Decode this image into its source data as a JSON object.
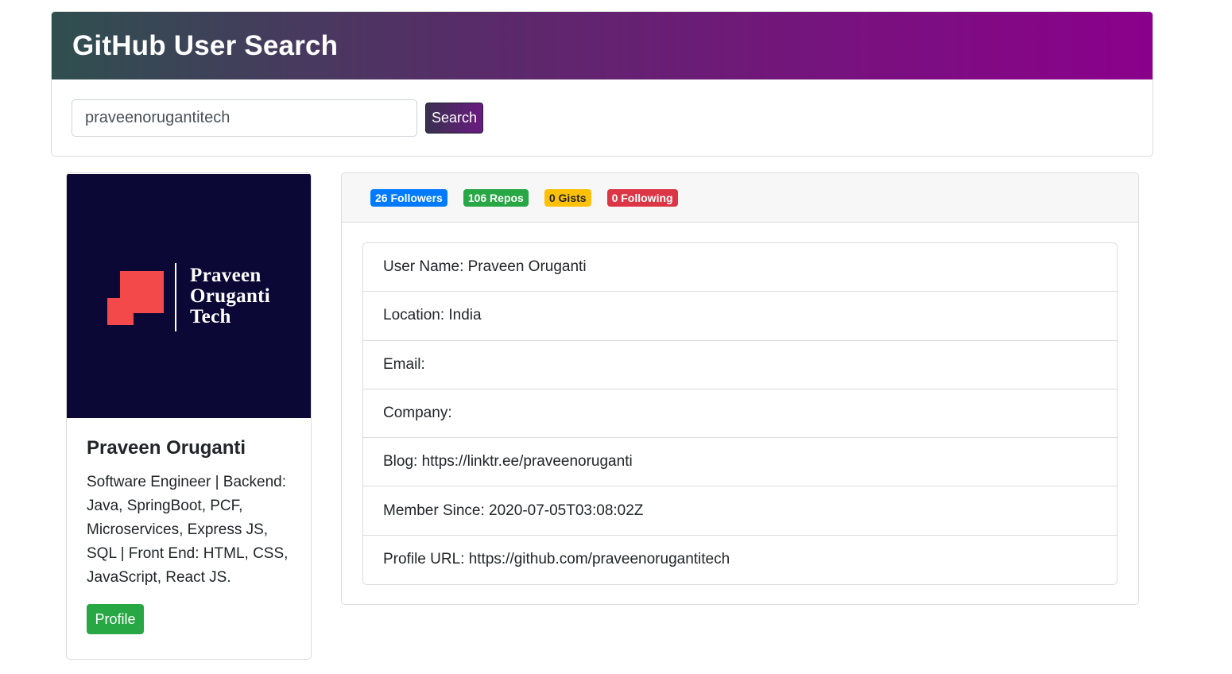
{
  "header": {
    "title": "GitHub User Search"
  },
  "search": {
    "value": "praveenorugantitech",
    "button_label": "Search"
  },
  "profile": {
    "avatar_logo_lines": [
      "Praveen",
      "Oruganti",
      "Tech"
    ],
    "name": "Praveen Oruganti",
    "bio": "Software Engineer | Backend: Java, SpringBoot, PCF, Microservices, Express JS, SQL | Front End: HTML, CSS, JavaScript, React JS.",
    "button_label": "Profile"
  },
  "stats": {
    "followers": "26 Followers",
    "repos": "106 Repos",
    "gists": "0 Gists",
    "following": "0 Following"
  },
  "details": [
    "User Name: Praveen Oruganti",
    "Location: India",
    "Email:",
    "Company:",
    "Blog: https://linktr.ee/praveenoruganti",
    "Member Since: 2020-07-05T03:08:02Z",
    "Profile URL: https://github.com/praveenorugantitech"
  ],
  "colors": {
    "header_gradient_start": "#2f4f4f",
    "header_gradient_end": "#8b008b",
    "followers_badge": "#007bff",
    "repos_badge": "#28a745",
    "gists_badge": "#ffc107",
    "following_badge": "#dc3545",
    "profile_button": "#28a745",
    "avatar_background": "#0c0836",
    "logo_accent": "#f4494b"
  }
}
